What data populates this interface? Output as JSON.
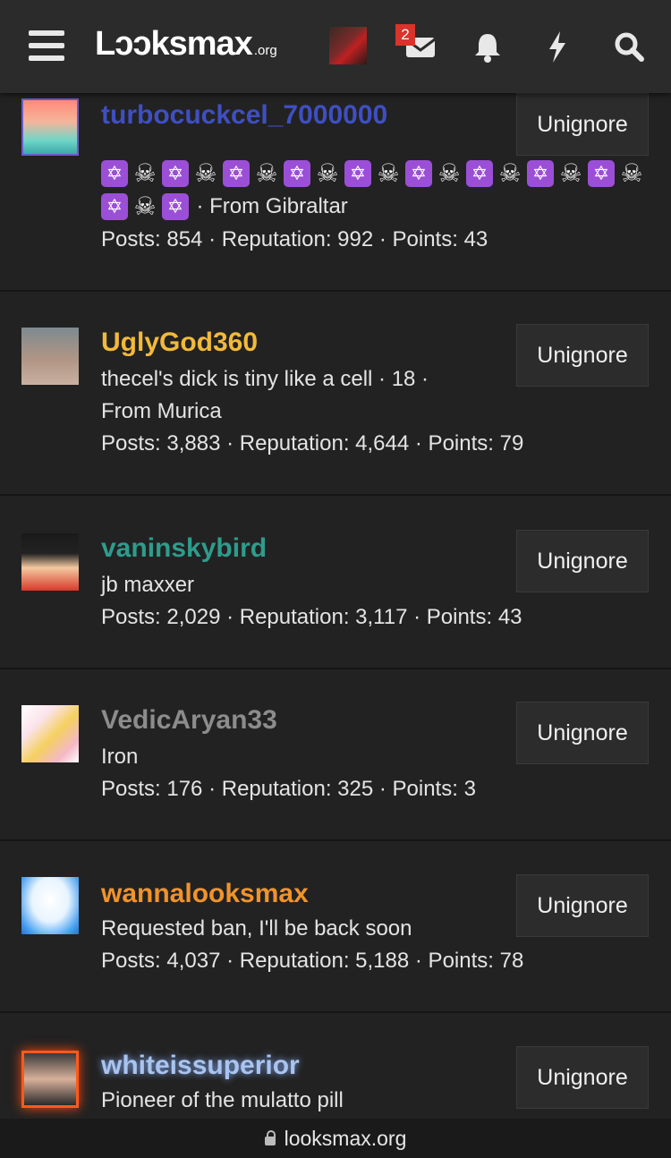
{
  "header": {
    "logo_text": "Lɔɔksmax",
    "logo_suffix": ".org",
    "inbox_badge": "2",
    "icons": [
      "menu-icon",
      "user-avatar",
      "inbox-icon",
      "bell-icon",
      "lightning-icon",
      "search-icon"
    ]
  },
  "members": [
    {
      "name": "turbocuckcel_7000000",
      "name_color": "#3f4fc2",
      "title_emoji_row1": "✡☠✡☠✡☠✡☠✡☠✡☠✡☠✡☠✡☠",
      "title_emoji_row2": "✡☠✡",
      "title_text": "· From Gibraltar",
      "stats": "Posts: 854 · Reputation: 992 · Points: 43",
      "button": "Unignore"
    },
    {
      "name": "UglyGod360",
      "name_color": "#f2b93b",
      "title_line1": "thecel's dick is tiny like a cell · 18 ·",
      "title_line2": "From Murica",
      "stats": "Posts: 3,883 · Reputation: 4,644 · Points: 79",
      "button": "Unignore"
    },
    {
      "name": "vaninskybird",
      "name_color": "#2e9c8c",
      "title_line1": "jb maxxer",
      "stats": "Posts: 2,029 · Reputation: 3,117 · Points: 43",
      "button": "Unignore"
    },
    {
      "name": "VedicAryan33",
      "name_color": "#8c8c8c",
      "title_line1": "Iron",
      "stats": "Posts: 176 · Reputation: 325 · Points: 3",
      "button": "Unignore"
    },
    {
      "name": "wannalooksmax",
      "name_color": "#f0932c",
      "title_line1": "Requested ban, I'll be back soon",
      "stats": "Posts: 4,037 · Reputation: 5,188 · Points: 78",
      "button": "Unignore"
    },
    {
      "name": "whiteissuperior",
      "name_color": "#a9c4ee",
      "title_line1": "Pioneer of the mulatto pill",
      "button": "Unignore"
    }
  ],
  "footer": {
    "url": "looksmax.org"
  }
}
